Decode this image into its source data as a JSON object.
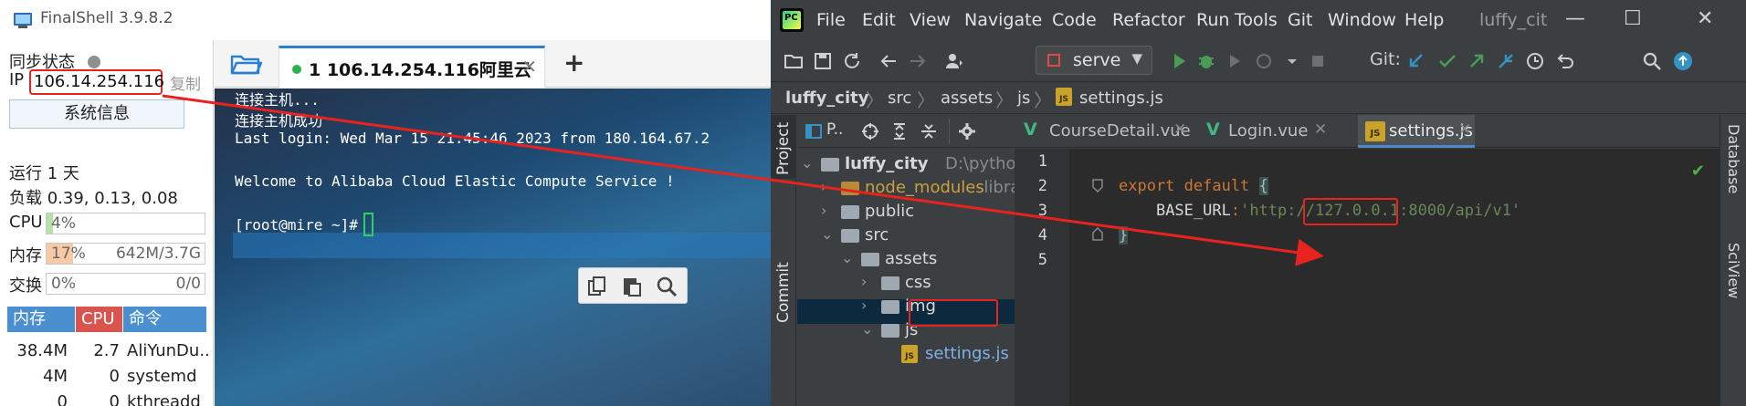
{
  "finalshell": {
    "title": "FinalShell 3.9.8.2",
    "sync_label": "同步状态",
    "ip_label": "IP",
    "ip_value": "106.14.254.116",
    "copy_label": "复制",
    "sysinfo_button": "系统信息",
    "uptime": "运行 1 天",
    "load": "负载 0.39, 0.13, 0.08",
    "cpu_label": "CPU",
    "cpu_value": "4%",
    "cpu_fraction": 0.04,
    "mem_label": "内存",
    "mem_value": "17%",
    "mem_fraction": 0.17,
    "mem_detail": "642M/3.7G",
    "swap_label": "交换",
    "swap_value": "0%",
    "swap_detail": "0/0",
    "proc_headers": {
      "mem": "内存",
      "cpu": "CPU",
      "cmd": "命令"
    },
    "processes": [
      {
        "mem": "38.4M",
        "cpu": "2.7",
        "cmd": "AliYunDu.."
      },
      {
        "mem": "4M",
        "cpu": "0",
        "cmd": "systemd"
      },
      {
        "mem": "0",
        "cpu": "0",
        "cmd": "kthreadd"
      }
    ],
    "tab": {
      "label": "1 106.14.254.116阿里云",
      "close": "✕"
    },
    "add_tab": "+",
    "terminal_lines": [
      "连接主机...",
      "连接主机成功",
      "Last login: Wed Mar 15 21:45:46 2023 from 180.164.67.2",
      "",
      "Welcome to Alibaba Cloud Elastic Compute Service !",
      "",
      "[root@mire ~]#"
    ],
    "colors": {
      "accent": "#2b7fd1",
      "cpu_bar": "#b5e0a8",
      "mem_bar": "#f7c9a5",
      "proc_mem": "#4a90d0",
      "proc_cpu": "#d9534f",
      "proc_cmd": "#4a90d0",
      "status_green": "#2bb24c"
    }
  },
  "pycharm": {
    "menu": [
      "File",
      "Edit",
      "View",
      "Navigate",
      "Code",
      "Refactor",
      "Run",
      "Tools",
      "Git",
      "Window",
      "Help"
    ],
    "project_title": "luffy_cit",
    "window_controls": {
      "minimize": "—",
      "maximize": "☐",
      "close": "✕"
    },
    "run_config": "serve",
    "git_label": "Git:",
    "breadcrumbs": [
      "luffy_city",
      "src",
      "assets",
      "js",
      "settings.js"
    ],
    "left_tabs": {
      "project": "Project",
      "commit": "Commit"
    },
    "right_tabs": {
      "database": "Database",
      "sciview": "SciView"
    },
    "project_toolbar_label": "P..",
    "tree": [
      {
        "name": "luffy_city",
        "hint": "D:\\pythonPro",
        "depth": 0,
        "arrow": "⌄",
        "type": "root"
      },
      {
        "name": "node_modules",
        "hint": "librar",
        "depth": 1,
        "arrow": "›",
        "type": "folder"
      },
      {
        "name": "public",
        "hint": "",
        "depth": 1,
        "arrow": "›",
        "type": "folder"
      },
      {
        "name": "src",
        "hint": "",
        "depth": 1,
        "arrow": "⌄",
        "type": "folder"
      },
      {
        "name": "assets",
        "hint": "",
        "depth": 2,
        "arrow": "⌄",
        "type": "folder"
      },
      {
        "name": "css",
        "hint": "",
        "depth": 3,
        "arrow": "›",
        "type": "folder"
      },
      {
        "name": "img",
        "hint": "",
        "depth": 3,
        "arrow": "›",
        "type": "folder"
      },
      {
        "name": "js",
        "hint": "",
        "depth": 3,
        "arrow": "⌄",
        "type": "folder"
      },
      {
        "name": "settings.js",
        "hint": "",
        "depth": 4,
        "arrow": "",
        "type": "jsfile"
      }
    ],
    "editor_tabs": [
      {
        "name": "CourseDetail.vue",
        "kind": "vue",
        "close": "✕"
      },
      {
        "name": "Login.vue",
        "kind": "vue",
        "close": "✕"
      },
      {
        "name": "settings.js",
        "kind": "js",
        "close": "✕",
        "active": true
      }
    ],
    "line_numbers": [
      "1",
      "2",
      "3",
      "4",
      "5"
    ],
    "code": {
      "line3_keyword": "export default",
      "line3_brace": "{",
      "line4_key": "BASE_URL",
      "line4_colon": ":",
      "line4_q1": "'http://",
      "line4_ip": "127.0.0.1",
      "line4_rest": ":8000/api/v1'",
      "line5_brace": "}"
    },
    "colors": {
      "bg": "#2b2b2b",
      "panel": "#3c3f41",
      "keyword": "#cc7832",
      "string": "#6a8759",
      "vue": "#41b883",
      "selection": "#0d293e"
    }
  }
}
